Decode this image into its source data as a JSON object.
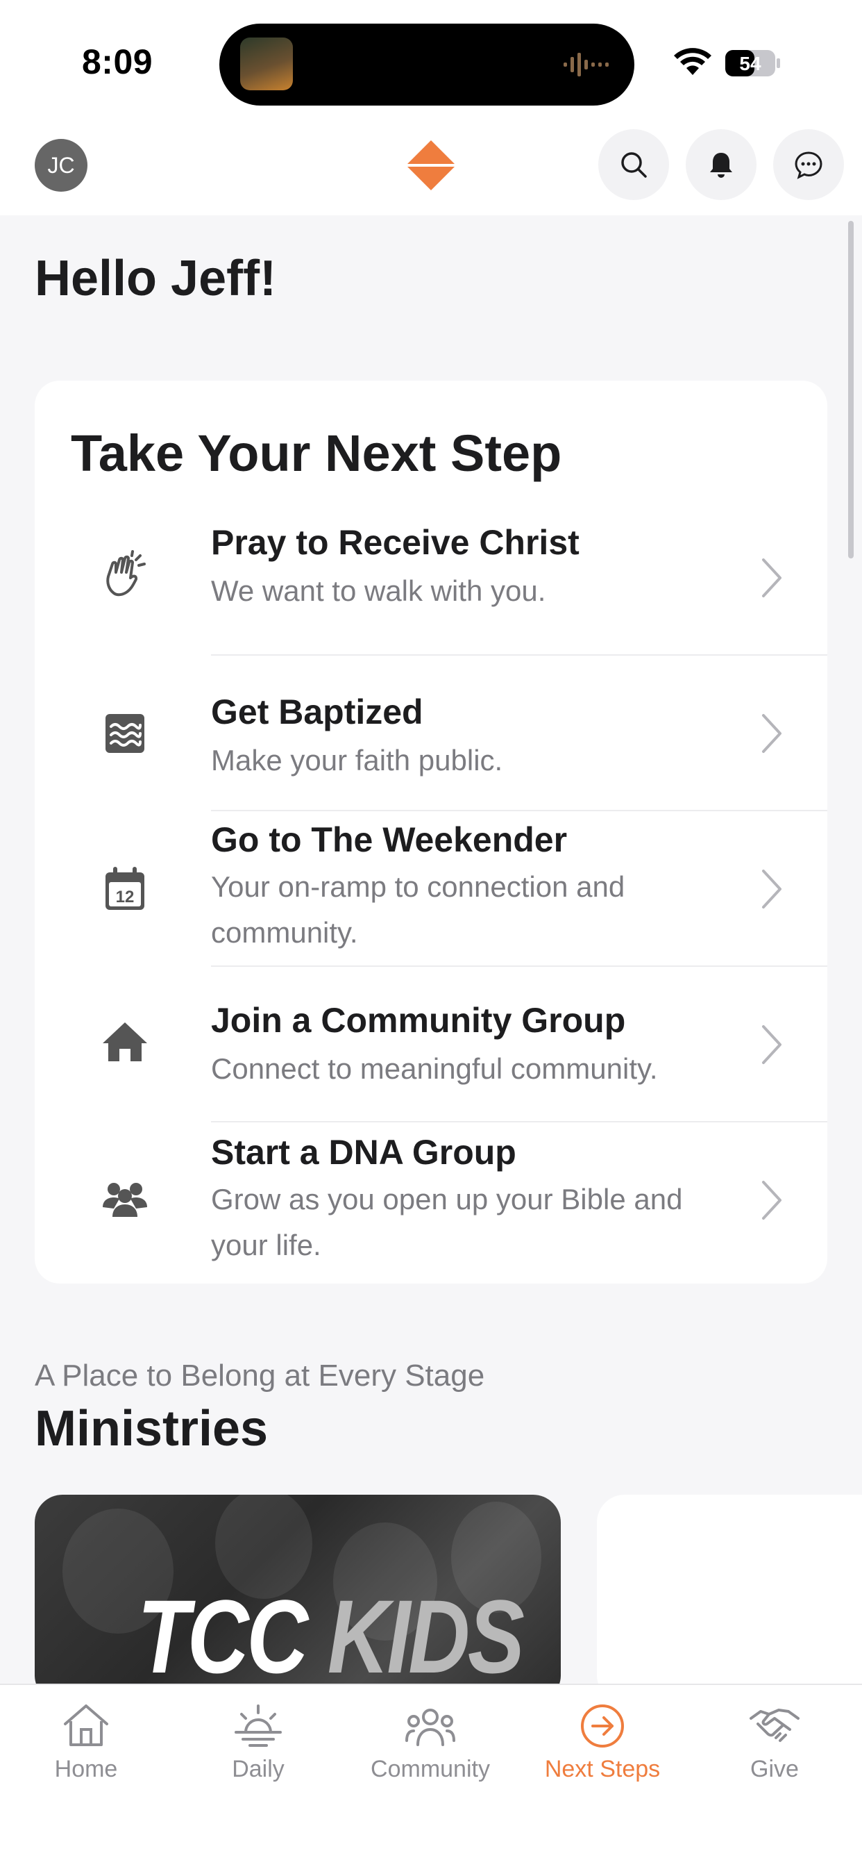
{
  "status_bar": {
    "time": "8:09",
    "battery": "54"
  },
  "header": {
    "avatar_initials": "JC",
    "logo_icon": "diamond-logo-icon",
    "icons": [
      "search-icon",
      "bell-icon",
      "chat-icon"
    ]
  },
  "greeting": "Hello Jeff!",
  "next_steps": {
    "title": "Take Your Next Step",
    "items": [
      {
        "title": "Pray to Receive Christ",
        "subtitle": "We want to walk with you.",
        "icon": "praying-hands-icon"
      },
      {
        "title": "Get Baptized",
        "subtitle": "Make your faith public.",
        "icon": "water-icon"
      },
      {
        "title": "Go to The Weekender",
        "subtitle": "Your on-ramp to connection and community.",
        "icon": "calendar-icon",
        "icon_text": "12"
      },
      {
        "title": "Join a Community Group",
        "subtitle": "Connect to meaningful community.",
        "icon": "house-icon"
      },
      {
        "title": "Start a DNA Group",
        "subtitle": "Grow as you open up your Bible and your life.",
        "icon": "people-group-icon"
      }
    ]
  },
  "ministries": {
    "subtitle": "A Place to Belong at Every Stage",
    "title": "Ministries",
    "card_text_a": "TCC",
    "card_text_b": "KIDS"
  },
  "tabbar": {
    "tabs": [
      {
        "label": "Home",
        "icon": "home-icon"
      },
      {
        "label": "Daily",
        "icon": "sunrise-icon"
      },
      {
        "label": "Community",
        "icon": "community-icon"
      },
      {
        "label": "Next Steps",
        "icon": "arrow-circle-icon",
        "active": true
      },
      {
        "label": "Give",
        "icon": "handshake-icon"
      }
    ]
  },
  "colors": {
    "accent": "#ef7d3e",
    "text_primary": "#1d1d1f",
    "text_secondary": "#7b7b80",
    "background": "#f6f6f8"
  }
}
